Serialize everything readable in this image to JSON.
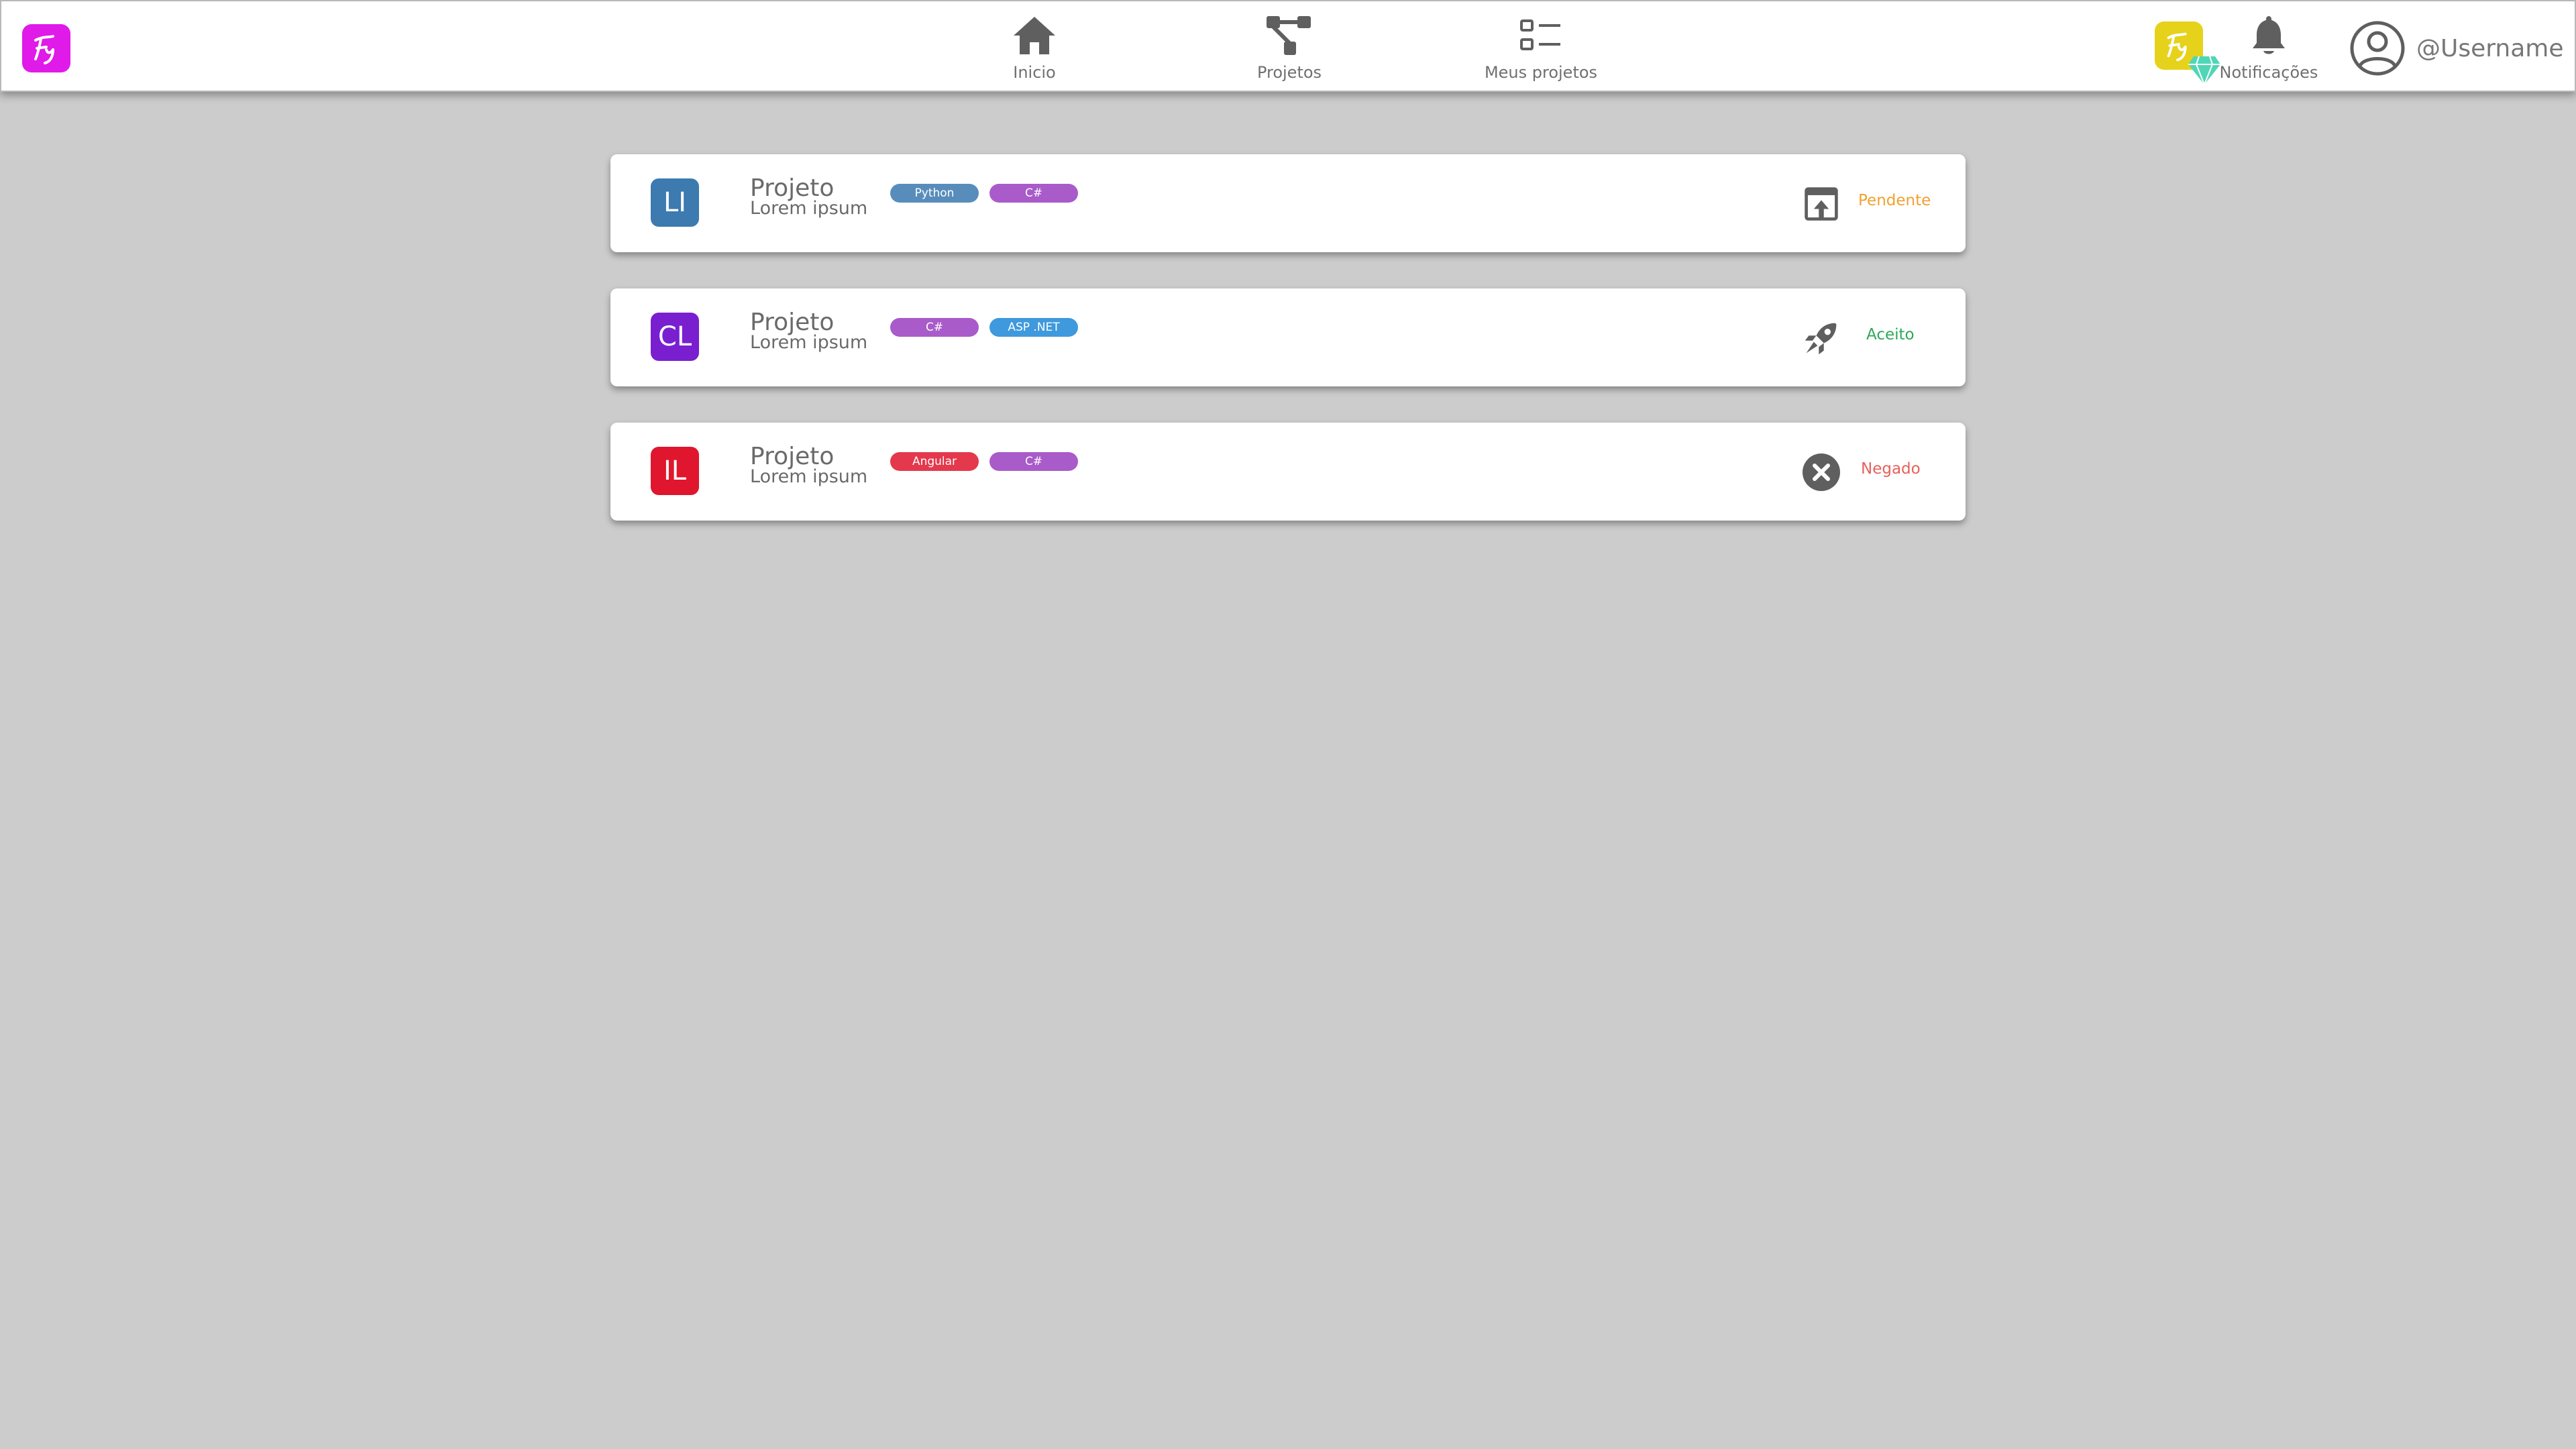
{
  "header": {
    "logo_icon": "fy-logo-icon",
    "logo_color": "#e01ae8",
    "nav": [
      {
        "label": "Inicio",
        "icon": "home-icon"
      },
      {
        "label": "Projetos",
        "icon": "project-tree-icon"
      },
      {
        "label": "Meus projetos",
        "icon": "list-icon"
      }
    ],
    "premium_badge": {
      "icon": "fy-premium-icon",
      "color": "#e6d21a",
      "diamond_icon": "diamond-icon",
      "diamond_color": "#4fd6b6"
    },
    "notifications": {
      "label": "Notificações",
      "icon": "bell-icon"
    },
    "user": {
      "username": "@Username",
      "icon": "user-avatar-icon"
    }
  },
  "projects": [
    {
      "initials": "LI",
      "initials_color": "#3c7ab0",
      "title": "Projeto",
      "subtitle": "Lorem ipsum",
      "tags": [
        {
          "label": "Python",
          "color": "#3c7ab0"
        },
        {
          "label": "C#",
          "color": "#9a3fc0"
        }
      ],
      "status": {
        "label": "Pendente",
        "icon": "open-in-upload-icon",
        "color": "#f0a030"
      }
    },
    {
      "initials": "CL",
      "initials_color": "#7a1fd0",
      "title": "Projeto",
      "subtitle": "Lorem ipsum",
      "tags": [
        {
          "label": "C#",
          "color": "#9a3fc0"
        },
        {
          "label": "ASP .NET",
          "color": "#1e88d8"
        }
      ],
      "status": {
        "label": "Aceito",
        "icon": "rocket-icon",
        "color": "#2ea85a"
      }
    },
    {
      "initials": "IL",
      "initials_color": "#e0162e",
      "title": "Projeto",
      "subtitle": "Lorem ipsum",
      "tags": [
        {
          "label": "Angular",
          "color": "#e0162e"
        },
        {
          "label": "C#",
          "color": "#9a3fc0"
        }
      ],
      "status": {
        "label": "Negado",
        "icon": "close-circle-icon",
        "color": "#e8605a"
      }
    }
  ]
}
